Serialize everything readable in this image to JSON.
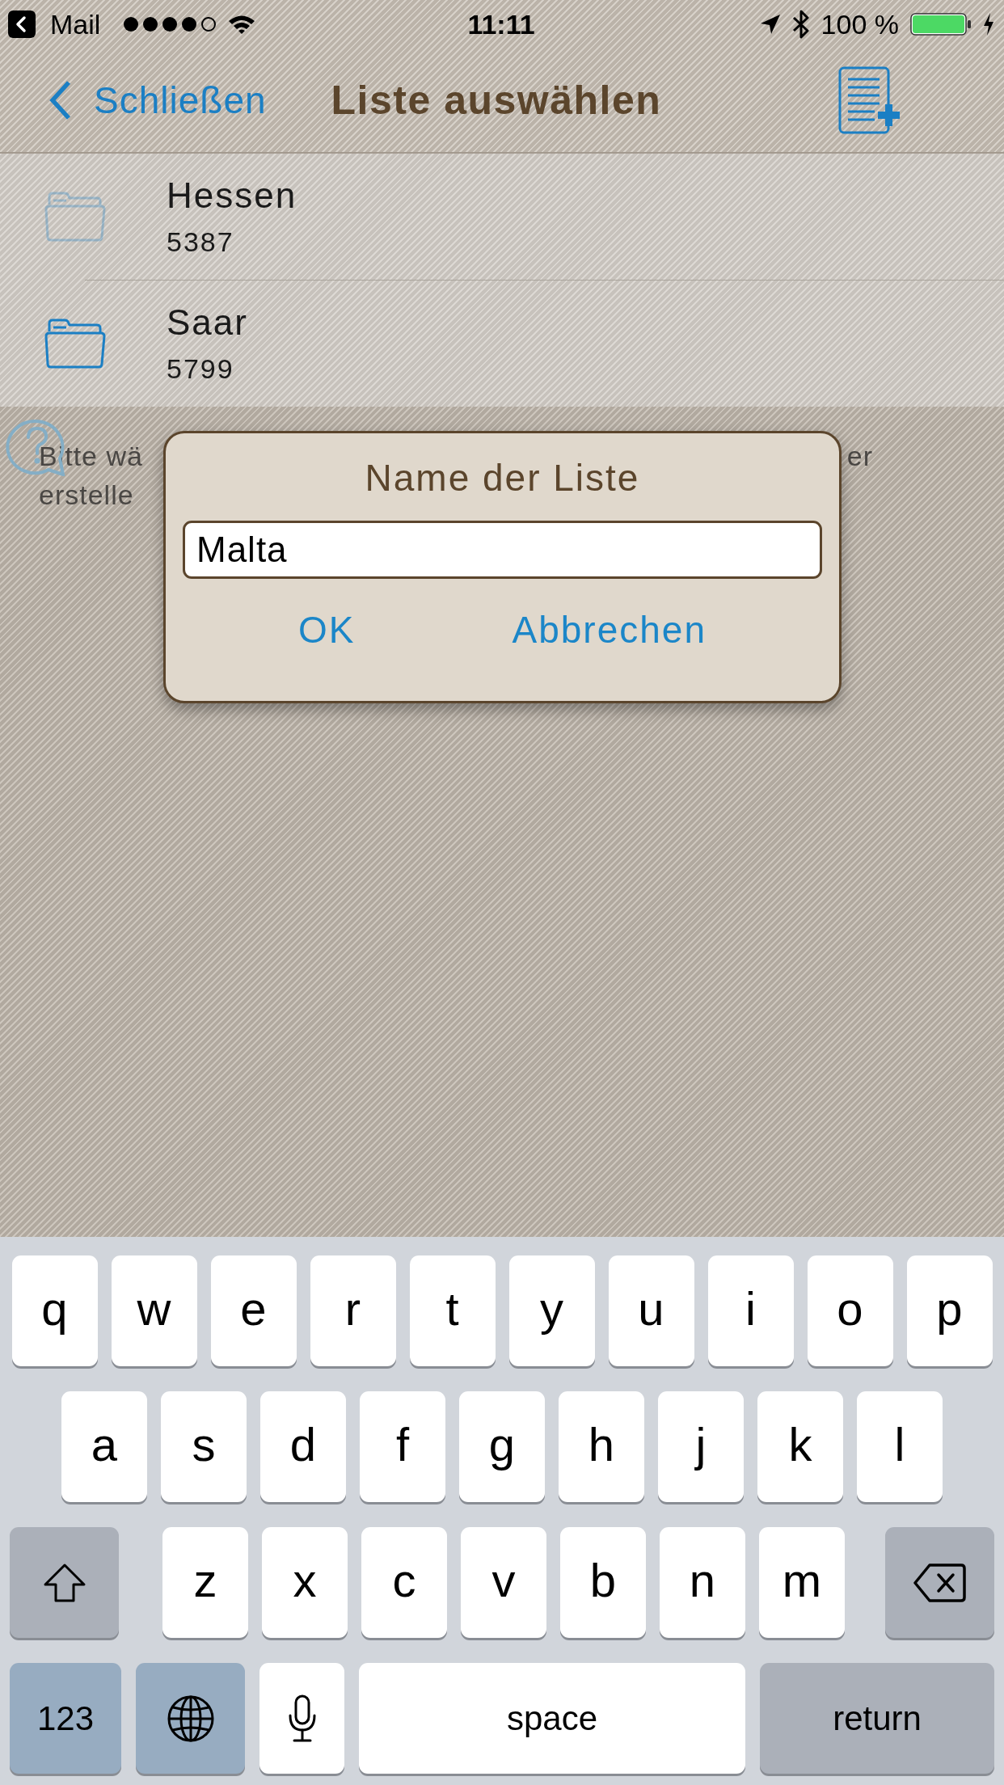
{
  "status_bar": {
    "back_app": "Mail",
    "time": "11:11",
    "battery": "100 %"
  },
  "nav": {
    "back": "Schließen",
    "title": "Liste auswählen"
  },
  "lists": [
    {
      "name": "Hessen",
      "count": "5387",
      "disabled": true
    },
    {
      "name": "Saar",
      "count": "5799",
      "disabled": false
    }
  ],
  "help_lines": [
    {
      "left": "Bitte wä",
      "right": "er"
    },
    {
      "left": "erstelle"
    }
  ],
  "dialog": {
    "title": "Name der Liste",
    "value": "Malta",
    "buttons": [
      "OK",
      "Abbrechen"
    ]
  },
  "keyboard": {
    "rows": [
      {
        "keys": [
          {
            "kind": "letter",
            "label": "q"
          },
          {
            "kind": "letter",
            "label": "w"
          },
          {
            "kind": "letter",
            "label": "e"
          },
          {
            "kind": "letter",
            "label": "r"
          },
          {
            "kind": "letter",
            "label": "t"
          },
          {
            "kind": "letter",
            "label": "y"
          },
          {
            "kind": "letter",
            "label": "u"
          },
          {
            "kind": "letter",
            "label": "i"
          },
          {
            "kind": "letter",
            "label": "o"
          },
          {
            "kind": "letter",
            "label": "p"
          }
        ]
      },
      {
        "keys": [
          {
            "kind": "letter",
            "label": "a"
          },
          {
            "kind": "letter",
            "label": "s"
          },
          {
            "kind": "letter",
            "label": "d"
          },
          {
            "kind": "letter",
            "label": "f"
          },
          {
            "kind": "letter",
            "label": "g"
          },
          {
            "kind": "letter",
            "label": "h"
          },
          {
            "kind": "letter",
            "label": "j"
          },
          {
            "kind": "letter",
            "label": "k"
          },
          {
            "kind": "letter",
            "label": "l"
          }
        ]
      },
      {
        "keys": [
          {
            "kind": "shift"
          },
          {
            "kind": "letter",
            "label": "z"
          },
          {
            "kind": "letter",
            "label": "x"
          },
          {
            "kind": "letter",
            "label": "c"
          },
          {
            "kind": "letter",
            "label": "v"
          },
          {
            "kind": "letter",
            "label": "b"
          },
          {
            "kind": "letter",
            "label": "n"
          },
          {
            "kind": "letter",
            "label": "m"
          },
          {
            "kind": "delete"
          }
        ]
      },
      {
        "keys": [
          {
            "kind": "numbers",
            "label": "123"
          },
          {
            "kind": "globe"
          },
          {
            "kind": "mic"
          },
          {
            "kind": "space",
            "label": "space"
          },
          {
            "kind": "return",
            "label": "return"
          }
        ]
      }
    ]
  }
}
